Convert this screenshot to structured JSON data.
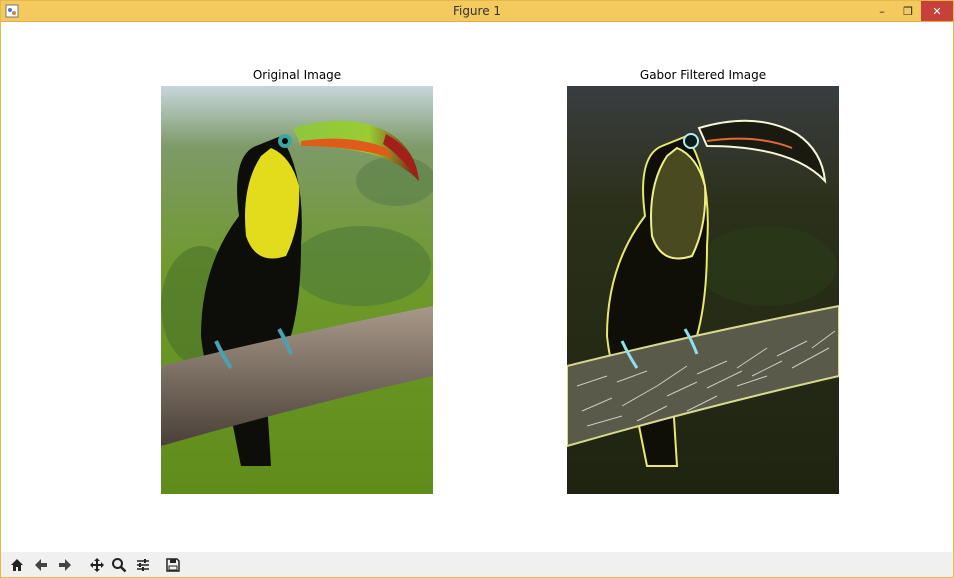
{
  "window": {
    "title": "Figure 1",
    "controls": {
      "minimize": "–",
      "restore": "❐",
      "close": "✕"
    }
  },
  "figure": {
    "axes": [
      {
        "title": "Original Image",
        "image": "toucan-photo"
      },
      {
        "title": "Gabor Filtered Image",
        "image": "toucan-gabor-filtered"
      }
    ]
  },
  "toolbar": {
    "buttons": [
      "home-icon",
      "back-icon",
      "forward-icon",
      "pan-icon",
      "zoom-icon",
      "configure-subplots-icon",
      "save-icon"
    ]
  },
  "colors": {
    "titlebar": "#f4c95d",
    "close_button": "#c7403a",
    "toolbar_bg": "#f0f0f0"
  }
}
